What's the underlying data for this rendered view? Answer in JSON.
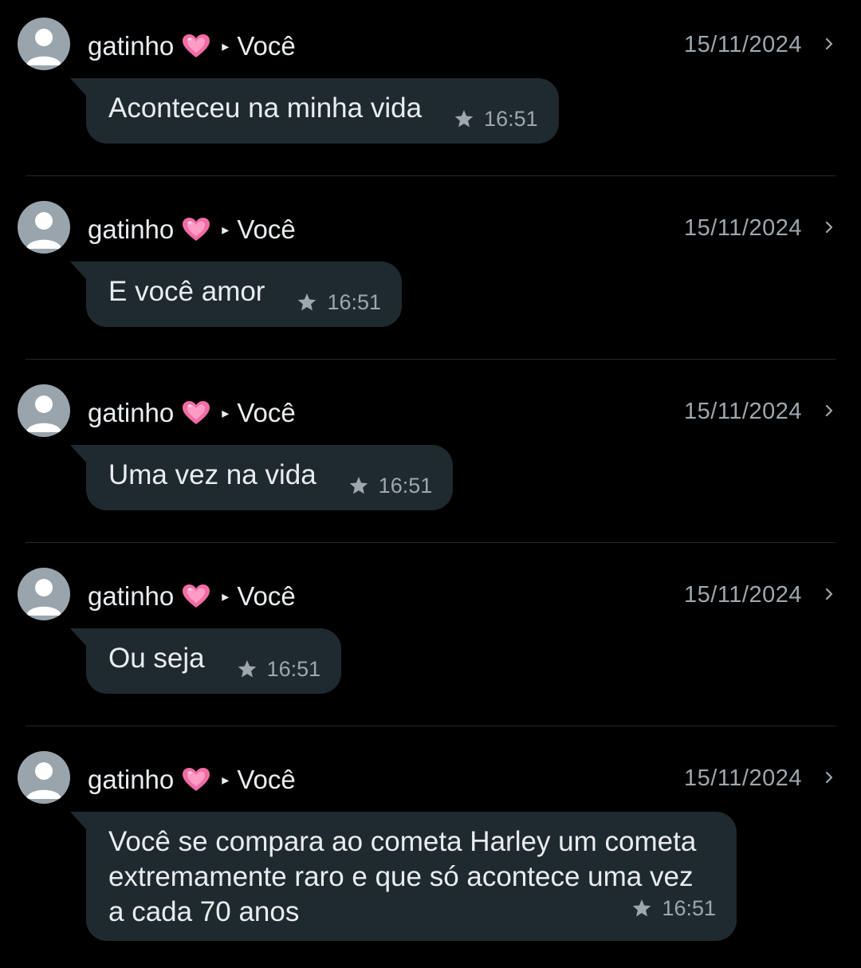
{
  "messages": [
    {
      "sender": "gatinho",
      "recipient": "Você",
      "date": "15/11/2024",
      "text": "Aconteceu na minha vida",
      "time": "16:51",
      "starred": true
    },
    {
      "sender": "gatinho",
      "recipient": "Você",
      "date": "15/11/2024",
      "text": "E você amor",
      "time": "16:51",
      "starred": true
    },
    {
      "sender": "gatinho",
      "recipient": "Você",
      "date": "15/11/2024",
      "text": "Uma vez na vida",
      "time": "16:51",
      "starred": true
    },
    {
      "sender": "gatinho",
      "recipient": "Você",
      "date": "15/11/2024",
      "text": "Ou seja",
      "time": "16:51",
      "starred": true
    },
    {
      "sender": "gatinho",
      "recipient": "Você",
      "date": "15/11/2024",
      "text": "Você se compara ao cometa Harley um cometa extremamente raro e que só acontece uma vez a cada 70 anos",
      "time": "16:51",
      "starred": true
    }
  ],
  "icons": {
    "avatar": "default-avatar-icon",
    "heart": "pink-heart-emoji",
    "arrow": "right-triangle-icon",
    "star": "star-icon",
    "chevron": "chevron-right-icon"
  },
  "colors": {
    "background": "#000000",
    "bubble": "#1f2a30",
    "text": "#e9edef",
    "muted": "#9ea7ad",
    "avatar": "#9aa4ac",
    "heart": "#f26ca6"
  }
}
